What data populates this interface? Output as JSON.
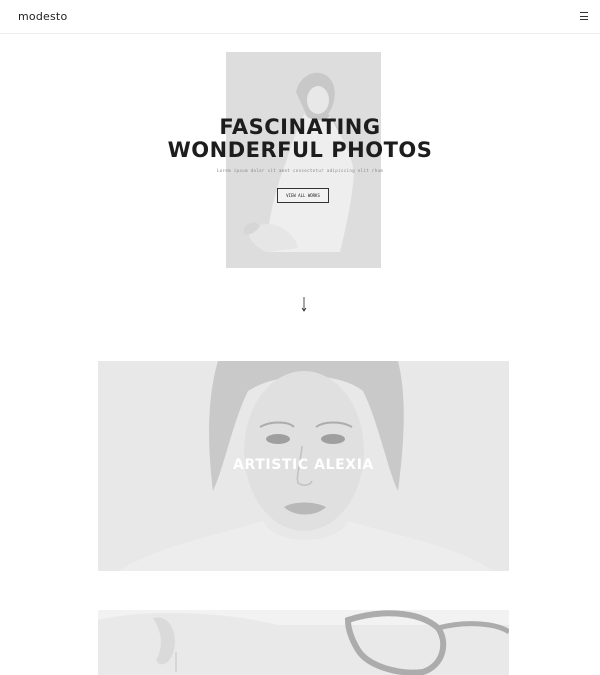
{
  "header": {
    "logo_text": "modesto",
    "menu_icon": "hamburger-menu-icon"
  },
  "hero": {
    "title_line1": "FASCINATING",
    "title_line2": "WONDERFUL PHOTOS",
    "subtitle": "Lorem ipsum dolor sit amet consectetur adipiscing elit rhum",
    "button_label": "VIEW ALL WORKS",
    "scroll_icon": "arrow-down-icon"
  },
  "gallery": {
    "items": [
      {
        "title": "ARTISTIC ALEXIA"
      },
      {
        "title": ""
      }
    ]
  },
  "colors": {
    "text_dark": "#1d1d1d",
    "overlay_text": "#ffffff",
    "photo_gray": "#d7d7d7"
  }
}
